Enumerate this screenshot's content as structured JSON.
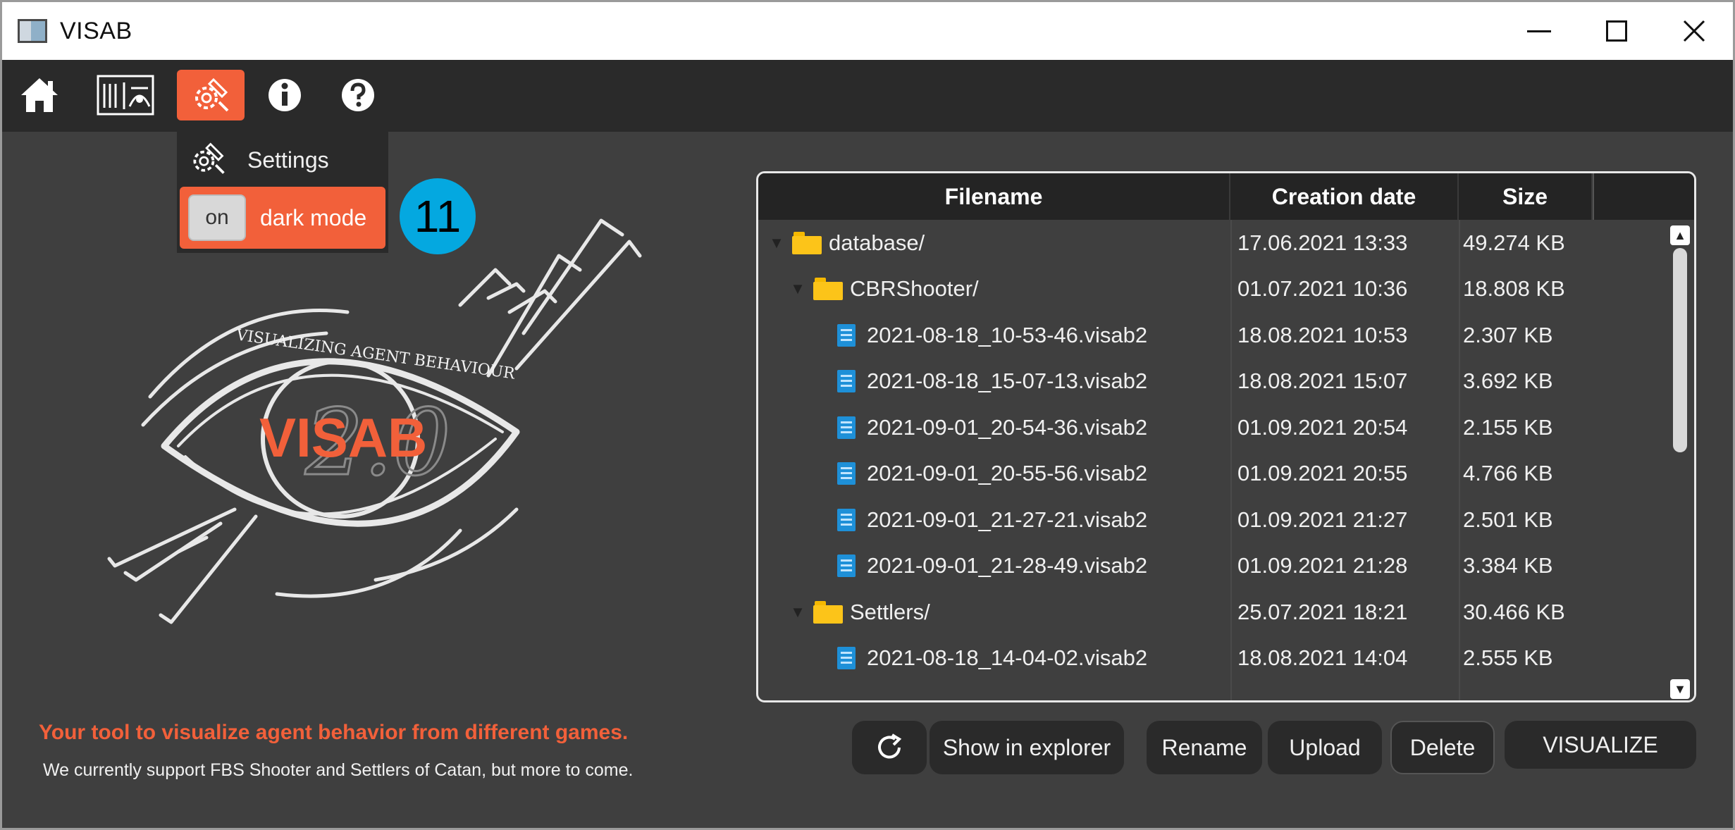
{
  "window": {
    "title": "VISAB"
  },
  "toolbar": {
    "items": [
      "home-icon",
      "data-view-icon",
      "settings-tools-icon",
      "info-icon",
      "help-icon"
    ],
    "active": "settings-tools-icon",
    "accent": "#f2603a"
  },
  "settings_menu": {
    "settings_label": "Settings",
    "toggle_label": "on",
    "dark_mode_label": "dark mode"
  },
  "annotation": {
    "number": "11",
    "color": "#04a8e0"
  },
  "logo": {
    "ring_text": "VISUALIZING AGENT BEHAVIOUR",
    "name": "VISAB",
    "version": "2.0"
  },
  "home": {
    "tagline": "Your tool to visualize agent behavior from different games.",
    "subline": "We currently support FBS Shooter and Settlers of Catan, but more to come."
  },
  "table": {
    "headers": {
      "name": "Filename",
      "date": "Creation date",
      "size": "Size"
    },
    "rows": [
      {
        "level": 0,
        "type": "folder",
        "name": "database/",
        "date": "17.06.2021 13:33",
        "size": "49.274 KB"
      },
      {
        "level": 1,
        "type": "folder",
        "name": "CBRShooter/",
        "date": "01.07.2021 10:36",
        "size": "18.808 KB"
      },
      {
        "level": 2,
        "type": "file",
        "name": "2021-08-18_10-53-46.visab2",
        "date": "18.08.2021 10:53",
        "size": "2.307 KB"
      },
      {
        "level": 2,
        "type": "file",
        "name": "2021-08-18_15-07-13.visab2",
        "date": "18.08.2021 15:07",
        "size": "3.692 KB"
      },
      {
        "level": 2,
        "type": "file",
        "name": "2021-09-01_20-54-36.visab2",
        "date": "01.09.2021 20:54",
        "size": "2.155 KB"
      },
      {
        "level": 2,
        "type": "file",
        "name": "2021-09-01_20-55-56.visab2",
        "date": "01.09.2021 20:55",
        "size": "4.766 KB"
      },
      {
        "level": 2,
        "type": "file",
        "name": "2021-09-01_21-27-21.visab2",
        "date": "01.09.2021 21:27",
        "size": "2.501 KB"
      },
      {
        "level": 2,
        "type": "file",
        "name": "2021-09-01_21-28-49.visab2",
        "date": "01.09.2021 21:28",
        "size": "3.384 KB"
      },
      {
        "level": 1,
        "type": "folder",
        "name": "Settlers/",
        "date": "25.07.2021 18:21",
        "size": "30.466 KB"
      },
      {
        "level": 2,
        "type": "file",
        "name": "2021-08-18_14-04-02.visab2",
        "date": "18.08.2021 14:04",
        "size": "2.555 KB"
      }
    ]
  },
  "buttons": {
    "refresh_icon": "refresh-icon",
    "show_in_explorer": "Show in explorer",
    "rename": "Rename",
    "upload": "Upload",
    "delete": "Delete",
    "visualize": "VISUALIZE"
  }
}
